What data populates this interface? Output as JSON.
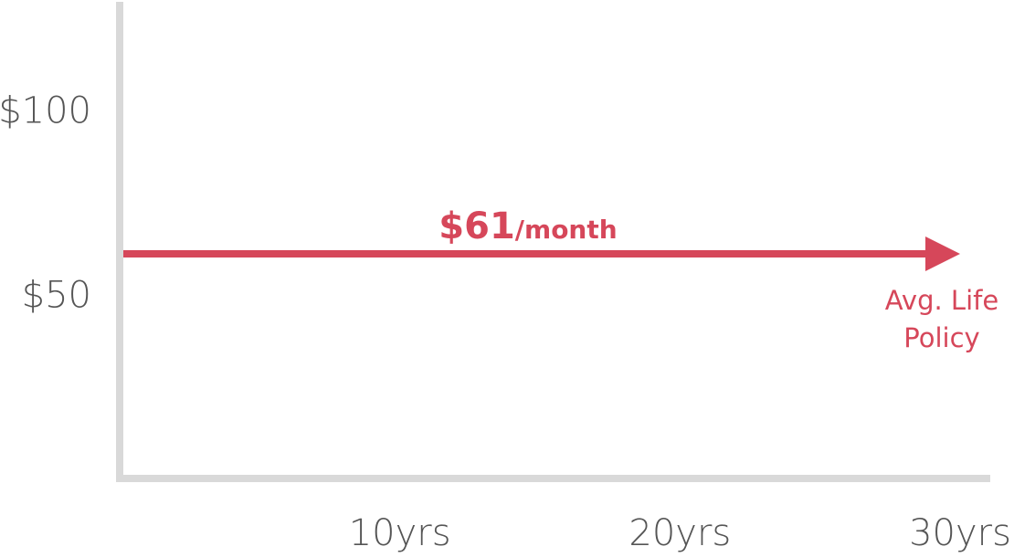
{
  "chart_data": {
    "type": "line",
    "x_ticks": [
      {
        "value": 10,
        "label": "10yrs"
      },
      {
        "value": 20,
        "label": "20yrs"
      },
      {
        "value": 30,
        "label": "30yrs"
      }
    ],
    "y_ticks": [
      {
        "value": 100,
        "label": "$100"
      },
      {
        "value": 50,
        "label": "$50"
      }
    ],
    "xlim": [
      0,
      30
    ],
    "ylim": [
      0,
      120
    ],
    "grid": false,
    "series": [
      {
        "name": "Avg. Life Policy",
        "name_lines": [
          "Avg. Life",
          "Policy"
        ],
        "x": [
          0,
          30
        ],
        "y": [
          61,
          61
        ],
        "annotation_value": "$61",
        "annotation_unit": "/month",
        "color": "#d6475a",
        "arrow_end": true
      }
    ],
    "colors": {
      "axis": "#d9d9d9",
      "tick_text": "#555555",
      "accent": "#d6475a"
    }
  }
}
